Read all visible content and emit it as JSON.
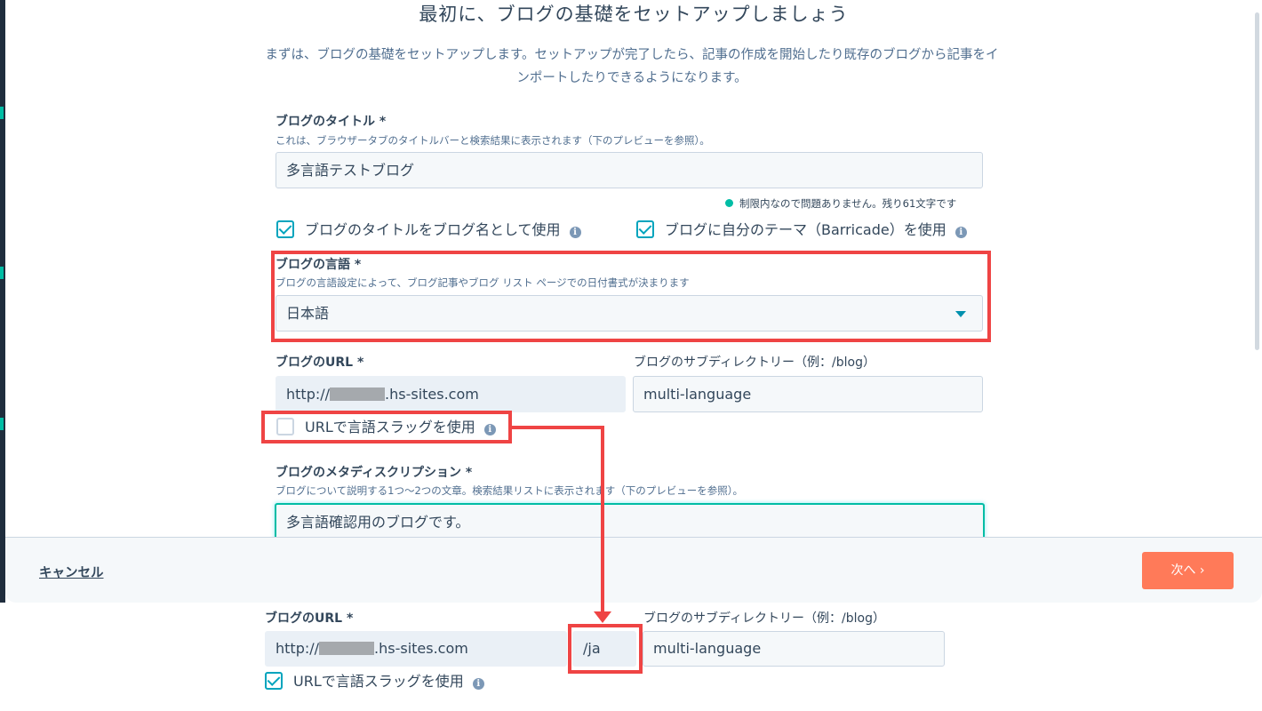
{
  "setup": {
    "heading": "最初に、ブログの基礎をセットアップしましょう",
    "intro": "まずは、ブログの基礎をセットアップします。セットアップが完了したら、記事の作成を開始したり既存のブログから記事をインポートしたりできるようになります。"
  },
  "title_field": {
    "label": "ブログのタイトル *",
    "help": "これは、ブラウザータブのタイトルバーと検索結果に表示されます（下のプレビューを参照）。",
    "value": "多言語テストブログ",
    "status": "制限内なので問題ありません。残り61文字です"
  },
  "options": {
    "use_title_as_name": {
      "label": "ブログのタイトルをブログ名として使用",
      "checked": true
    },
    "use_own_theme": {
      "label": "ブログに自分のテーマ（Barricade）を使用",
      "checked": true
    }
  },
  "language_field": {
    "label": "ブログの言語 *",
    "help": "ブログの言語設定によって、ブログ記事やブログ リスト ページでの日付書式が決まります",
    "selected": "日本語"
  },
  "url_field": {
    "label": "ブログのURL *",
    "prefix": "http://",
    "suffix": ".hs-sites.com"
  },
  "subdir_field": {
    "label": "ブログのサブディレクトリー（例：/blog）",
    "value": "multi-language"
  },
  "language_slug": {
    "label": "URLで言語スラッグを使用",
    "checked": false
  },
  "meta_field": {
    "label": "ブログのメタディスクリプション *",
    "help": "ブログについて説明する1つ〜2つの文章。検索結果リストに表示されます（下のプレビューを参照）。",
    "value": "多言語確認用のブログです。"
  },
  "footer": {
    "cancel": "キャンセル",
    "next": "次へ ›"
  },
  "after": {
    "url_label": "ブログのURL *",
    "url_prefix": "http://",
    "url_suffix": ".hs-sites.com",
    "slug": "/ja",
    "subdir_label": "ブログのサブディレクトリー（例：/blog）",
    "subdir_value": "multi-language",
    "slug_option_label": "URLで言語スラッグを使用",
    "slug_option_checked": true
  },
  "colors": {
    "accent": "#00a4bd",
    "primary_button": "#ff7a59",
    "annotation": "#ef4444",
    "text": "#33475b"
  },
  "icons": [
    "info-icon",
    "checkbox-checked-icon",
    "checkbox-unchecked-icon",
    "caret-down-icon",
    "chevron-right-icon",
    "arrow-connector"
  ]
}
